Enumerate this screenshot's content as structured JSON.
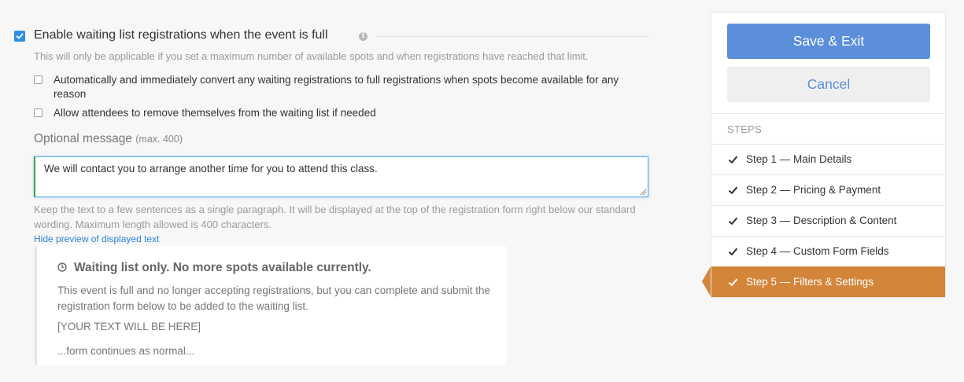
{
  "waitlist": {
    "enable_label": "Enable waiting list registrations when the event is full",
    "enable_checked": true,
    "info_icon": "info-icon",
    "note": "This will only be applicable if you set a maximum number of available spots and when registrations have reached that limit.",
    "options": [
      {
        "label": "Automatically and immediately convert any waiting registrations to full registrations when spots become available for any reason",
        "checked": false
      },
      {
        "label": "Allow attendees to remove themselves from the waiting list if needed",
        "checked": false
      }
    ],
    "message_label": "Optional message",
    "message_limit": "(max. 400)",
    "message_value": "We will contact you to arrange another time for you to attend this class.",
    "help_text": "Keep the text to a few sentences as a single paragraph. It will be displayed at the top of the registration form right below our standard wording. Maximum length allowed is 400 characters.",
    "hide_preview_link": "Hide preview of displayed text"
  },
  "preview": {
    "icon": "clock-icon",
    "heading": "Waiting list only. No more spots available currently.",
    "body": "This event is full and no longer accepting registrations, but you can complete and submit the registration form below to be added to the waiting list.",
    "placeholder": "[YOUR TEXT WILL BE HERE]",
    "continuation": "...form continues as normal..."
  },
  "sidebar": {
    "save_label": "Save & Exit",
    "cancel_label": "Cancel",
    "steps_title": "STEPS",
    "steps": [
      {
        "label": "Step 1 — Main Details",
        "done": true,
        "active": false
      },
      {
        "label": "Step 2 — Pricing & Payment",
        "done": true,
        "active": false
      },
      {
        "label": "Step 3 — Description & Content",
        "done": true,
        "active": false
      },
      {
        "label": "Step 4 — Custom Form Fields",
        "done": true,
        "active": false
      },
      {
        "label": "Step 5 — Filters & Settings",
        "done": true,
        "active": true
      }
    ]
  },
  "colors": {
    "primary": "#5b8fd9",
    "checkbox": "#2d8fe5",
    "active_step": "#d3853a",
    "link": "#2d84d6"
  }
}
